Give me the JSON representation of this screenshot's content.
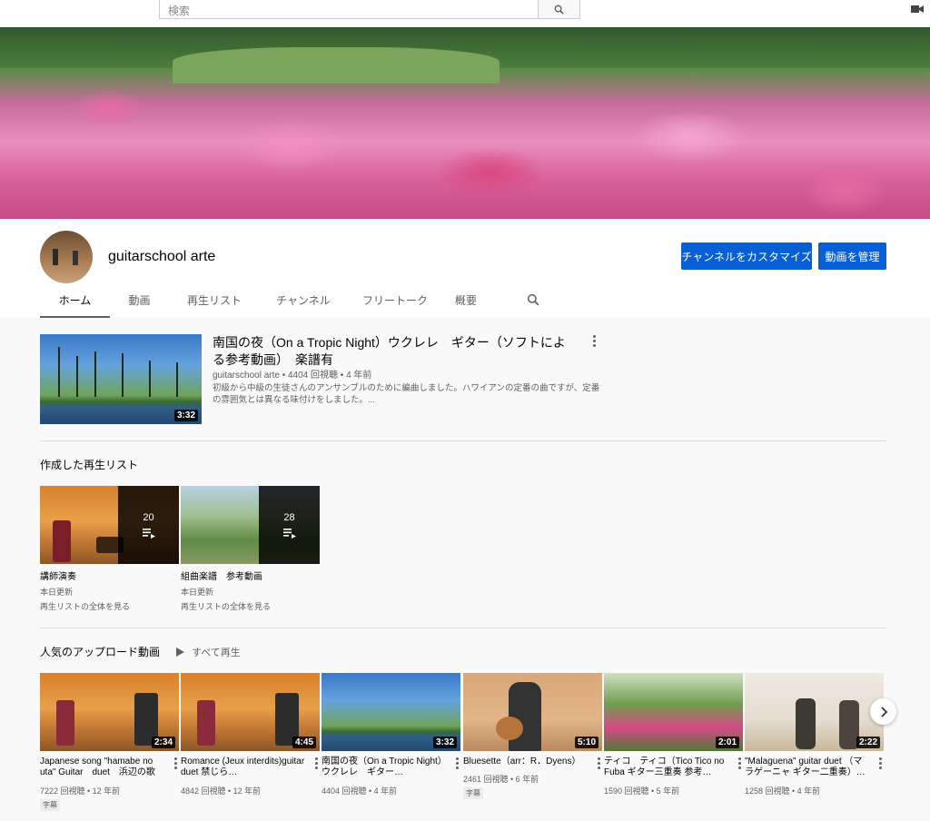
{
  "search": {
    "placeholder": "検索"
  },
  "channel": {
    "name": "guitarschool arte"
  },
  "buttons": {
    "customize": "チャンネルをカスタマイズ",
    "manage": "動画を管理"
  },
  "tabs": [
    "ホーム",
    "動画",
    "再生リスト",
    "チャンネル",
    "フリートーク",
    "概要"
  ],
  "featured": {
    "title": "南国の夜（On a Tropic Night）ウクレレ　ギター（ソフトによる参考動画）　楽譜有",
    "meta": "guitarschool arte • 4404 回視聴 • 4 年前",
    "description": "初級から中級の生徒さんのアンサンブルのために編曲しました。ハワイアンの定番の曲ですが、定番の雰囲気とは異なる味付けをしました。...",
    "duration": "3:32"
  },
  "playlists_section": {
    "title": "作成した再生リスト",
    "items": [
      {
        "title": "講師演奏",
        "count": "20",
        "updated": "本日更新",
        "view_all": "再生リストの全体を見る"
      },
      {
        "title": "組曲楽譜　参考動画",
        "count": "28",
        "updated": "本日更新",
        "view_all": "再生リストの全体を見る"
      }
    ]
  },
  "uploads_section": {
    "title": "人気のアップロード動画",
    "play_all": "すべて再生",
    "items": [
      {
        "title": "Japanese song \"hamabe no uta\" Guitar　duet　浜辺の歌",
        "meta": "7222 回視聴 • 12 年前",
        "badge": "字幕",
        "duration": "2:34"
      },
      {
        "title": "Romance (Jeux interdits)guitar duet 禁じら…",
        "meta": "4842 回視聴 • 12 年前",
        "badge": "",
        "duration": "4:45"
      },
      {
        "title": "南国の夜（On a Tropic Night）ウクレレ　ギター…",
        "meta": "4404 回視聴 • 4 年前",
        "badge": "",
        "duration": "3:32"
      },
      {
        "title": "Bluesette（arr：R．Dyens）",
        "meta": "2461 回視聴 • 6 年前",
        "badge": "字幕",
        "duration": "5:10"
      },
      {
        "title": "ティコ　ティコ（Tico Tico no Fuba ギター三重奏 参考…",
        "meta": "1590 回視聴 • 5 年前",
        "badge": "",
        "duration": "2:01"
      },
      {
        "title": "\"Malaguena\" guitar duet （マラゲーニャ ギター二重奏）…",
        "meta": "1258 回視聴 • 4 年前",
        "badge": "",
        "duration": "2:22"
      }
    ]
  },
  "colors": {
    "accent": "#065fd4",
    "background": "#f9f9f9"
  },
  "icons": {
    "search": "search-icon",
    "camera": "video-camera-icon",
    "more": "more-vert-icon",
    "playlist": "playlist-icon",
    "play": "play-icon",
    "next": "chevron-right-icon"
  }
}
